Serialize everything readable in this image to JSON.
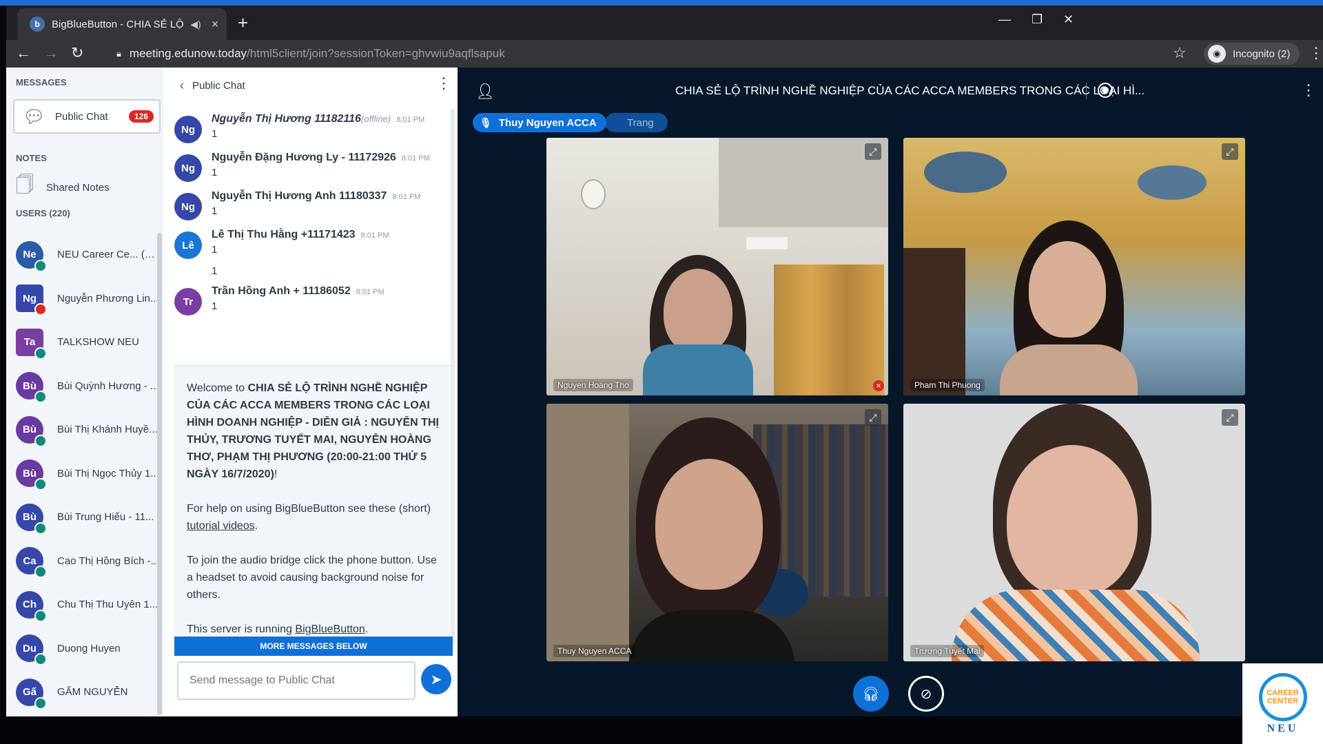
{
  "browser": {
    "tab_title": "BigBlueButton - CHIA SẺ LỘ",
    "tab_favicon": "b",
    "url_host": "meeting.edunow.today",
    "url_path": "/html5client/join?sessionToken=ghvwiu9aqflsapuk",
    "incognito_label": "Incognito (2)"
  },
  "sidebar": {
    "messages_heading": "MESSAGES",
    "public_chat_label": "Public Chat",
    "public_chat_badge": "126",
    "notes_heading": "NOTES",
    "shared_notes_label": "Shared Notes",
    "users_heading": "USERS (220)",
    "users": [
      {
        "initials": "Ne",
        "name": "NEU Career Ce... (You)",
        "color": "#2b5aa8"
      },
      {
        "initials": "Ng",
        "name": "Nguyễn Phương Lin...",
        "color": "#3547a8"
      },
      {
        "initials": "Ta",
        "name": "TALKSHOW NEU",
        "color": "#7a3ea0"
      },
      {
        "initials": "Bù",
        "name": "Bùi Quỳnh Hương - ...",
        "color": "#6a3aa0"
      },
      {
        "initials": "Bù",
        "name": "Bùi Thị Khánh Huyề...",
        "color": "#6a3aa0"
      },
      {
        "initials": "Bù",
        "name": "Bùi Thị Ngọc Thủy 1...",
        "color": "#6a3aa0"
      },
      {
        "initials": "Bù",
        "name": "Bùi Trung Hiếu - 11...",
        "color": "#3547a8"
      },
      {
        "initials": "Ca",
        "name": "Cao Thị Hồng Bích -...",
        "color": "#3547a8"
      },
      {
        "initials": "Ch",
        "name": "Chu Thị Thu Uyên 1...",
        "color": "#3547a8"
      },
      {
        "initials": "Du",
        "name": "Duong Huyen",
        "color": "#3547a8"
      },
      {
        "initials": "Gấ",
        "name": "GẤM NGUYỄN",
        "color": "#3547a8"
      }
    ]
  },
  "chat": {
    "header": "Public Chat",
    "messages": [
      {
        "initials": "Ng",
        "name": "Nguyễn Thị Hương 11182116",
        "offline": "(offline)",
        "time": "8:01 PM",
        "text": "1",
        "text2": "",
        "color": "#3547a8"
      },
      {
        "initials": "Ng",
        "name": "Nguyễn Đặng Hương Ly - 11172926",
        "offline": "",
        "time": "8:01 PM",
        "text": "1",
        "text2": "",
        "color": "#3547a8"
      },
      {
        "initials": "Ng",
        "name": "Nguyễn Thị Hương Anh 11180337",
        "offline": "",
        "time": "8:01 PM",
        "text": "1",
        "text2": "",
        "color": "#3547a8"
      },
      {
        "initials": "Lê",
        "name": "Lê Thị Thu Hằng +11171423",
        "offline": "",
        "time": "8:01 PM",
        "text": "1",
        "text2": "1",
        "color": "#1976d2"
      },
      {
        "initials": "Tr",
        "name": "Trần Hồng Anh + 11186052",
        "offline": "",
        "time": "8:01 PM",
        "text": "1",
        "text2": "",
        "color": "#7a3ea0"
      }
    ],
    "welcome_prefix": "Welcome to ",
    "welcome_title": "CHIA SẺ LỘ TRÌNH NGHỀ NGHIỆP CỦA CÁC ACCA MEMBERS TRONG CÁC LOẠI HÌNH DOANH NGHIỆP - DIỄN GIẢ : NGUYỄN THỊ THỦY, TRƯƠNG TUYẾT MAI, NGUYỄN HOÀNG THƠ, PHẠM THỊ PHƯƠNG (20:00-21:00 THỨ 5 NGÀY 16/7/2020)",
    "welcome_suffix": "!",
    "help_prefix": "For help on using BigBlueButton see these (short) ",
    "help_link": "tutorial videos",
    "help_suffix": ".",
    "audio_text": "To join the audio bridge click the phone button. Use a headset to avoid causing background noise for others.",
    "server_prefix": "This server is running ",
    "server_link": "BigBlueButton",
    "server_suffix": ".",
    "more_messages": "MORE MESSAGES BELOW",
    "input_placeholder": "Send message to Public Chat"
  },
  "main": {
    "meeting_title": "CHIA SẺ LỘ TRÌNH NGHỀ NGHIỆP CỦA CÁC ACCA MEMBERS TRONG CÁC LOẠI HÌ...",
    "talking_active": "Thuy Nguyen ACCA",
    "talking_other": "Trang",
    "videos": [
      {
        "label": "Nguyen Hoang Tho"
      },
      {
        "label": "Pham Thi Phuong"
      },
      {
        "label": "Thuy Nguyen ACCA"
      },
      {
        "label": "Trương Tuyết Mai"
      }
    ]
  },
  "watermark": {
    "line1": "CAREER",
    "line2": "CENTER",
    "brand": "NEU"
  }
}
